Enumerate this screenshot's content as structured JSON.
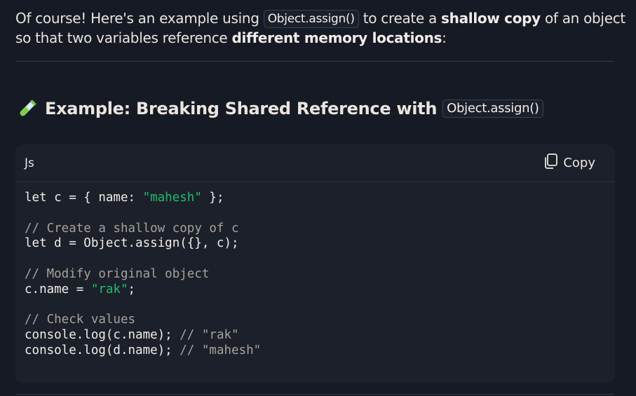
{
  "intro": {
    "part1": "Of course! Here's an example using ",
    "code": "Object.assign()",
    "part2": " to create a ",
    "bold1": "shallow copy",
    "part3": " of an object so that two variables reference ",
    "bold2": "different memory locations",
    "part4": ":"
  },
  "heading": {
    "icon": "test-tube-icon",
    "text": "Example: Breaking Shared Reference with",
    "code": "Object.assign()"
  },
  "code_block": {
    "language": "Js",
    "copy_label": "Copy",
    "lines": [
      [
        {
          "t": "let c = { name: "
        },
        {
          "t": "\"mahesh\"",
          "k": "str"
        },
        {
          "t": " };"
        }
      ],
      [],
      [
        {
          "t": "// Create a shallow copy of c",
          "k": "com"
        }
      ],
      [
        {
          "t": "let d = Object.assign({}, c);"
        }
      ],
      [],
      [
        {
          "t": "// Modify original object",
          "k": "com"
        }
      ],
      [
        {
          "t": "c.name = "
        },
        {
          "t": "\"rak\"",
          "k": "str"
        },
        {
          "t": ";"
        }
      ],
      [],
      [
        {
          "t": "// Check values",
          "k": "com"
        }
      ],
      [
        {
          "t": "console.log(c.name); "
        },
        {
          "t": "// \"rak\"",
          "k": "com"
        }
      ],
      [
        {
          "t": "console.log(d.name); "
        },
        {
          "t": "// \"mahesh\"",
          "k": "com"
        }
      ]
    ]
  },
  "colors": {
    "background": "#161a24",
    "code_background": "#1c202a",
    "string": "#1fbd6b",
    "comment": "#a7a19b"
  }
}
